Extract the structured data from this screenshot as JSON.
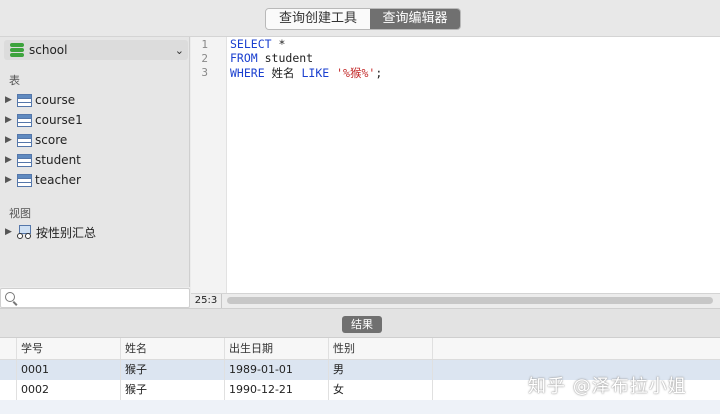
{
  "toolbar": {
    "tab_query_builder": "查询创建工具",
    "tab_query_editor": "查询编辑器"
  },
  "sidebar": {
    "database": "school",
    "tables_label": "表",
    "tables": [
      "course",
      "course1",
      "score",
      "student",
      "teacher"
    ],
    "views_label": "视图",
    "views": [
      "按性别汇总"
    ],
    "search_placeholder": ""
  },
  "editor": {
    "line_numbers": [
      "1",
      "2",
      "3"
    ],
    "line1_kw": "SELECT",
    "line1_rest": " *",
    "line2_kw": "FROM",
    "line2_rest": " student",
    "line3_kw1": "WHERE",
    "line3_mid": " 姓名 ",
    "line3_kw2": "LIKE",
    "line3_str": " '%猴%'",
    "line3_end": ";",
    "cursor_position": "25:3"
  },
  "results": {
    "tab_label": "结果",
    "columns": [
      "学号",
      "姓名",
      "出生日期",
      "性别"
    ],
    "rows": [
      [
        "0001",
        "猴子",
        "1989-01-01",
        "男"
      ],
      [
        "0002",
        "猴子",
        "1990-12-21",
        "女"
      ]
    ]
  },
  "watermark": "知乎 @泽布拉小姐",
  "colors": {
    "keyword": "#1a3fcf",
    "string": "#c32a2a",
    "selected_row": "#dce5f1",
    "segment_active": "#707070"
  }
}
